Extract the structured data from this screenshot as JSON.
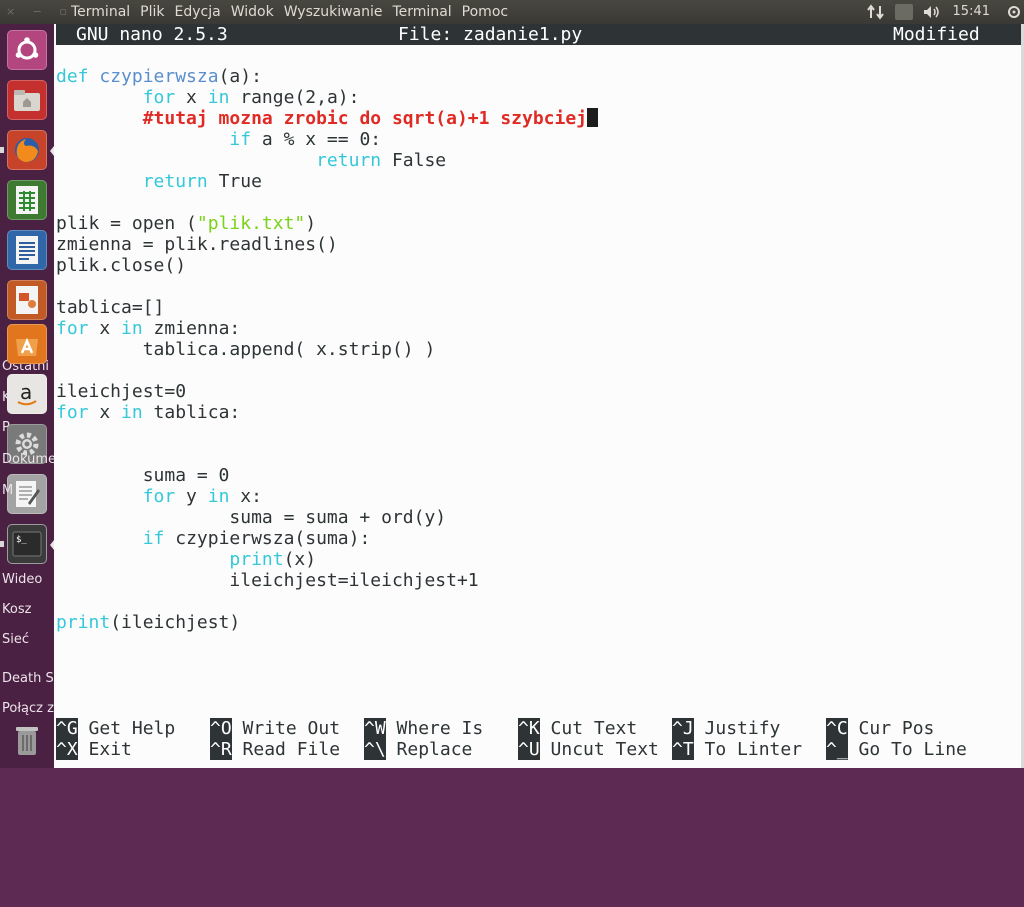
{
  "menubar": {
    "items": [
      "Terminal",
      "Plik",
      "Edycja",
      "Widok",
      "Wyszukiwanie",
      "Terminal",
      "Pomoc"
    ],
    "window_controls": "× − ▫",
    "clock": "15:41"
  },
  "desktop_items": [
    "Ostatni",
    "K",
    "P",
    "Dokume",
    "M",
    "Wideo",
    "Kosz",
    "Sieć",
    "Death S",
    "Połącz z"
  ],
  "nano": {
    "version": "GNU nano 2.5.3",
    "file": "File: zadanie1.py",
    "status": "Modified"
  },
  "code": {
    "l1": [
      "def",
      " ",
      "czypierwsza",
      "(a):"
    ],
    "l2": [
      "        ",
      "for",
      " x ",
      "in",
      " range(2,a):"
    ],
    "l3": [
      "        ",
      "#tutaj mozna zrobic do sqrt(a)+1 szybciej"
    ],
    "l4": [
      "                ",
      "if",
      " a % x == 0:"
    ],
    "l5": [
      "                        ",
      "return",
      " False"
    ],
    "l6": [
      "        ",
      "return",
      " True"
    ],
    "l7": [
      ""
    ],
    "l8": [
      "plik = open (",
      "\"plik.txt\"",
      ")"
    ],
    "l9": [
      "zmienna = plik.readlines()"
    ],
    "l10": [
      "plik.close()"
    ],
    "l11": [
      ""
    ],
    "l12": [
      "tablica=[]"
    ],
    "l13": [
      "for",
      " x ",
      "in",
      " zmienna:"
    ],
    "l14": [
      "        tablica.append( x.strip() )"
    ],
    "l15": [
      ""
    ],
    "l16": [
      "ileichjest=0"
    ],
    "l17": [
      "for",
      " x ",
      "in",
      " tablica:"
    ],
    "l18": [
      ""
    ],
    "l19": [
      ""
    ],
    "l20": [
      "        suma = 0"
    ],
    "l21": [
      "        ",
      "for",
      " y ",
      "in",
      " x:"
    ],
    "l22": [
      "                suma = suma + ord(y)"
    ],
    "l23": [
      "        ",
      "if",
      " czypierwsza(suma):"
    ],
    "l24": [
      "                ",
      "print",
      "(x)"
    ],
    "l25": [
      "                ileichjest=ileichjest+1"
    ],
    "l26": [
      ""
    ],
    "l27": [
      "print",
      "(ileichjest)"
    ]
  },
  "shortcuts": {
    "row1": [
      {
        "key": "^G",
        "label": " Get Help"
      },
      {
        "key": "^O",
        "label": " Write Out"
      },
      {
        "key": "^W",
        "label": " Where Is"
      },
      {
        "key": "^K",
        "label": " Cut Text"
      },
      {
        "key": "^J",
        "label": " Justify"
      },
      {
        "key": "^C",
        "label": " Cur Pos"
      }
    ],
    "row2": [
      {
        "key": "^X",
        "label": " Exit"
      },
      {
        "key": "^R",
        "label": " Read File"
      },
      {
        "key": "^\\",
        "label": " Replace"
      },
      {
        "key": "^U",
        "label": " Uncut Text"
      },
      {
        "key": "^T",
        "label": " To Linter"
      },
      {
        "key": "^_",
        "label": " Go To Line"
      }
    ]
  },
  "launcher": [
    "ubuntu-logo-icon",
    "files-icon",
    "firefox-icon",
    "spreadsheet-icon",
    "writer-icon",
    "impress-icon",
    "software-center-icon",
    "amazon-icon",
    "settings-icon",
    "text-editor-icon",
    "terminal-icon",
    "trash-icon"
  ],
  "colors": {
    "keyword": "#34c8d8",
    "function": "#5a8ecc",
    "string": "#7ad21a",
    "comment": "#e02a24",
    "text": "#2e3436",
    "titlebar": "#2e3436"
  }
}
